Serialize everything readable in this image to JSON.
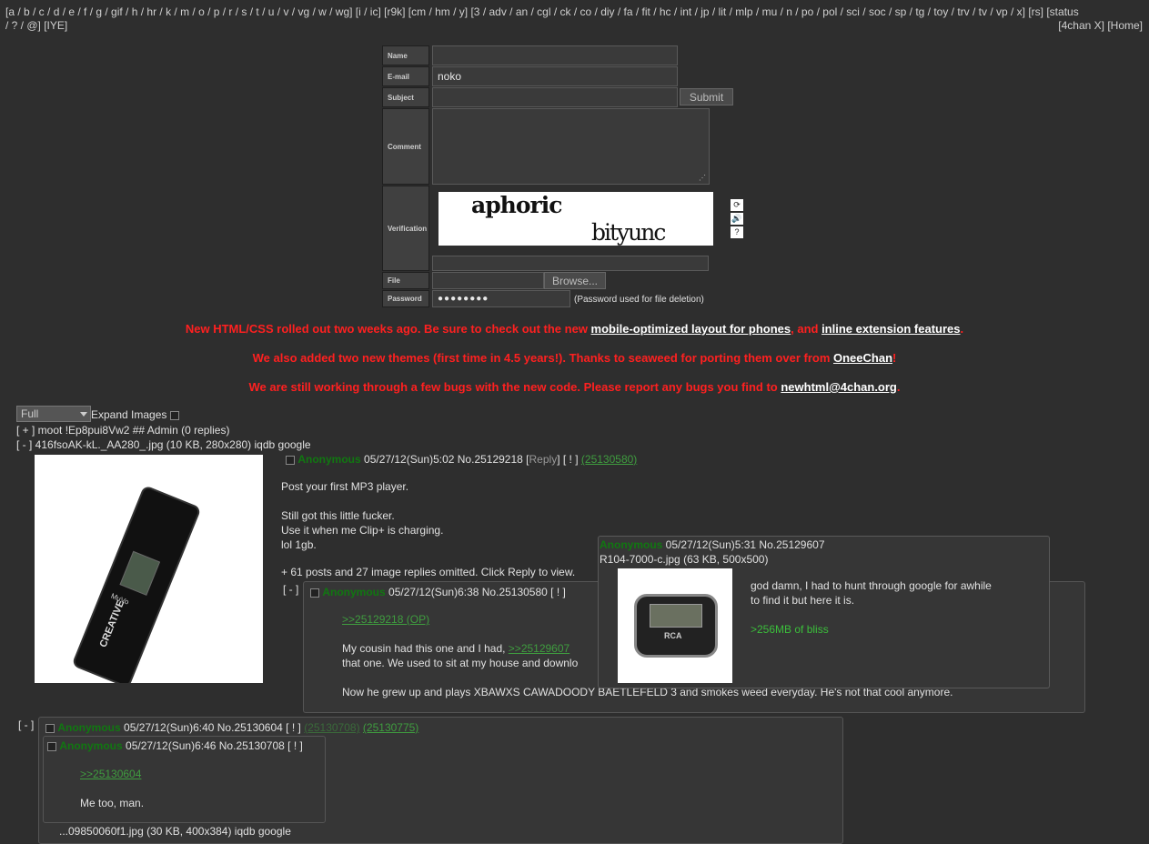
{
  "boardlist": {
    "line1": "[a / b / c / d / e / f / g / gif / h / hr / k / m / o / p / r / s / t / u / v / vg / w / wg] [i / ic] [r9k] [cm / hm / y] [3 / adv / an / cgl / ck / co / diy / fa / fit / hc / int / jp / lit / mlp / mu / n / po / pol / sci / soc / sp / tg / toy / trv / tv / vp / x] [rs] [status",
    "line2": "/ ? / @] [IYE]",
    "right": "[4chan X] [Home]"
  },
  "form": {
    "name_label": "Name",
    "email_label": "E-mail",
    "email_value": "noko",
    "subject_label": "Subject",
    "submit": "Submit",
    "comment_label": "Comment",
    "verification_label": "Verification",
    "captcha_word1": "aphoric",
    "captcha_word2": "bityunc",
    "file_label": "File",
    "browse": "Browse...",
    "password_label": "Password",
    "password_value": "●●●●●●●●",
    "password_note": "(Password used for file deletion)"
  },
  "news": {
    "l1a": "New HTML/CSS rolled out two weeks ago. Be sure to check out the new ",
    "l1b": "mobile-optimized layout for phones",
    "l1c": ", and ",
    "l1d": "inline extension features",
    "l1e": ".",
    "l2a": "We also added two new themes (first time in 4.5 years!). Thanks to seaweed for porting them over from ",
    "l2b": "OneeChan",
    "l2c": "!",
    "l3a": "We are still working through a few bugs with the new code. Please report any bugs you find to ",
    "l3b": "newhtml@4chan.org",
    "l3c": "."
  },
  "controls": {
    "select_value": "Full",
    "expand": "Expand Images"
  },
  "sticky": "[ + ] moot !Ep8pui8Vw2 ## Admin (0 replies)",
  "op": {
    "file_prefix": "[ - ] ",
    "file_name": "416fsoAK-kL._AA280_.jpg",
    "file_info": " (10 KB, 280x280) ",
    "iqdb": "iqdb",
    "google": "google",
    "name": "Anonymous",
    "date": " 05/27/12(Sun)5:02 No.25129218 ",
    "reply_open": "[",
    "reply": "Reply",
    "reply_close": "]",
    "report": "[ ! ]",
    "backlink": "(25130580)",
    "comment1": "Post your first MP3 player.",
    "comment2": "Still got this little fucker.",
    "comment3": "Use it when me Clip+ is charging.",
    "comment4": "lol 1gb.",
    "omitted": "+ 61 posts and 27 image replies omitted. Click Reply to view.",
    "image_brand": "CREATIVE",
    "image_model": "MuVo"
  },
  "reply1": {
    "toggle": "[ - ]",
    "name": "Anonymous",
    "date": " 05/27/12(Sun)6:38 No.25130580 ",
    "report": "[ ! ]",
    "quote": ">>25129218 (OP)",
    "text1a": "My cousin had this one and I had, ",
    "text1b": ">>25129607",
    "text2": "that one. We used to sit at my house and downlo",
    "text3": "Now he grew up and plays XBAWXS CAWADOODY BAETLEFELD 3 and smokes weed everyday. He's not that cool anymore."
  },
  "hover": {
    "name": "Anonymous",
    "date": " 05/27/12(Sun)5:31 No.25129607",
    "file_name": "R104-7000-c.jpg",
    "file_info": " (63 KB, 500x500)",
    "text1": "god damn, I had to hunt through google for awhile",
    "text2": "to find it but here it is.",
    "greentext": ">256MB of bliss",
    "image_brand": "RCA"
  },
  "reply2": {
    "toggle": "[ - ]",
    "name": "Anonymous",
    "date": " 05/27/12(Sun)6:40 No.25130604 ",
    "report": "[ ! ]",
    "backlink1": "(25130708)",
    "backlink2": "(25130775)"
  },
  "reply3": {
    "name": "Anonymous",
    "date": " 05/27/12(Sun)6:46 No.25130708 ",
    "report": "[ ! ]",
    "quote": ">>25130604",
    "text": "Me too, man."
  },
  "cut_line": "...09850060f1.jpg (30 KB, 400x384) iqdb google"
}
